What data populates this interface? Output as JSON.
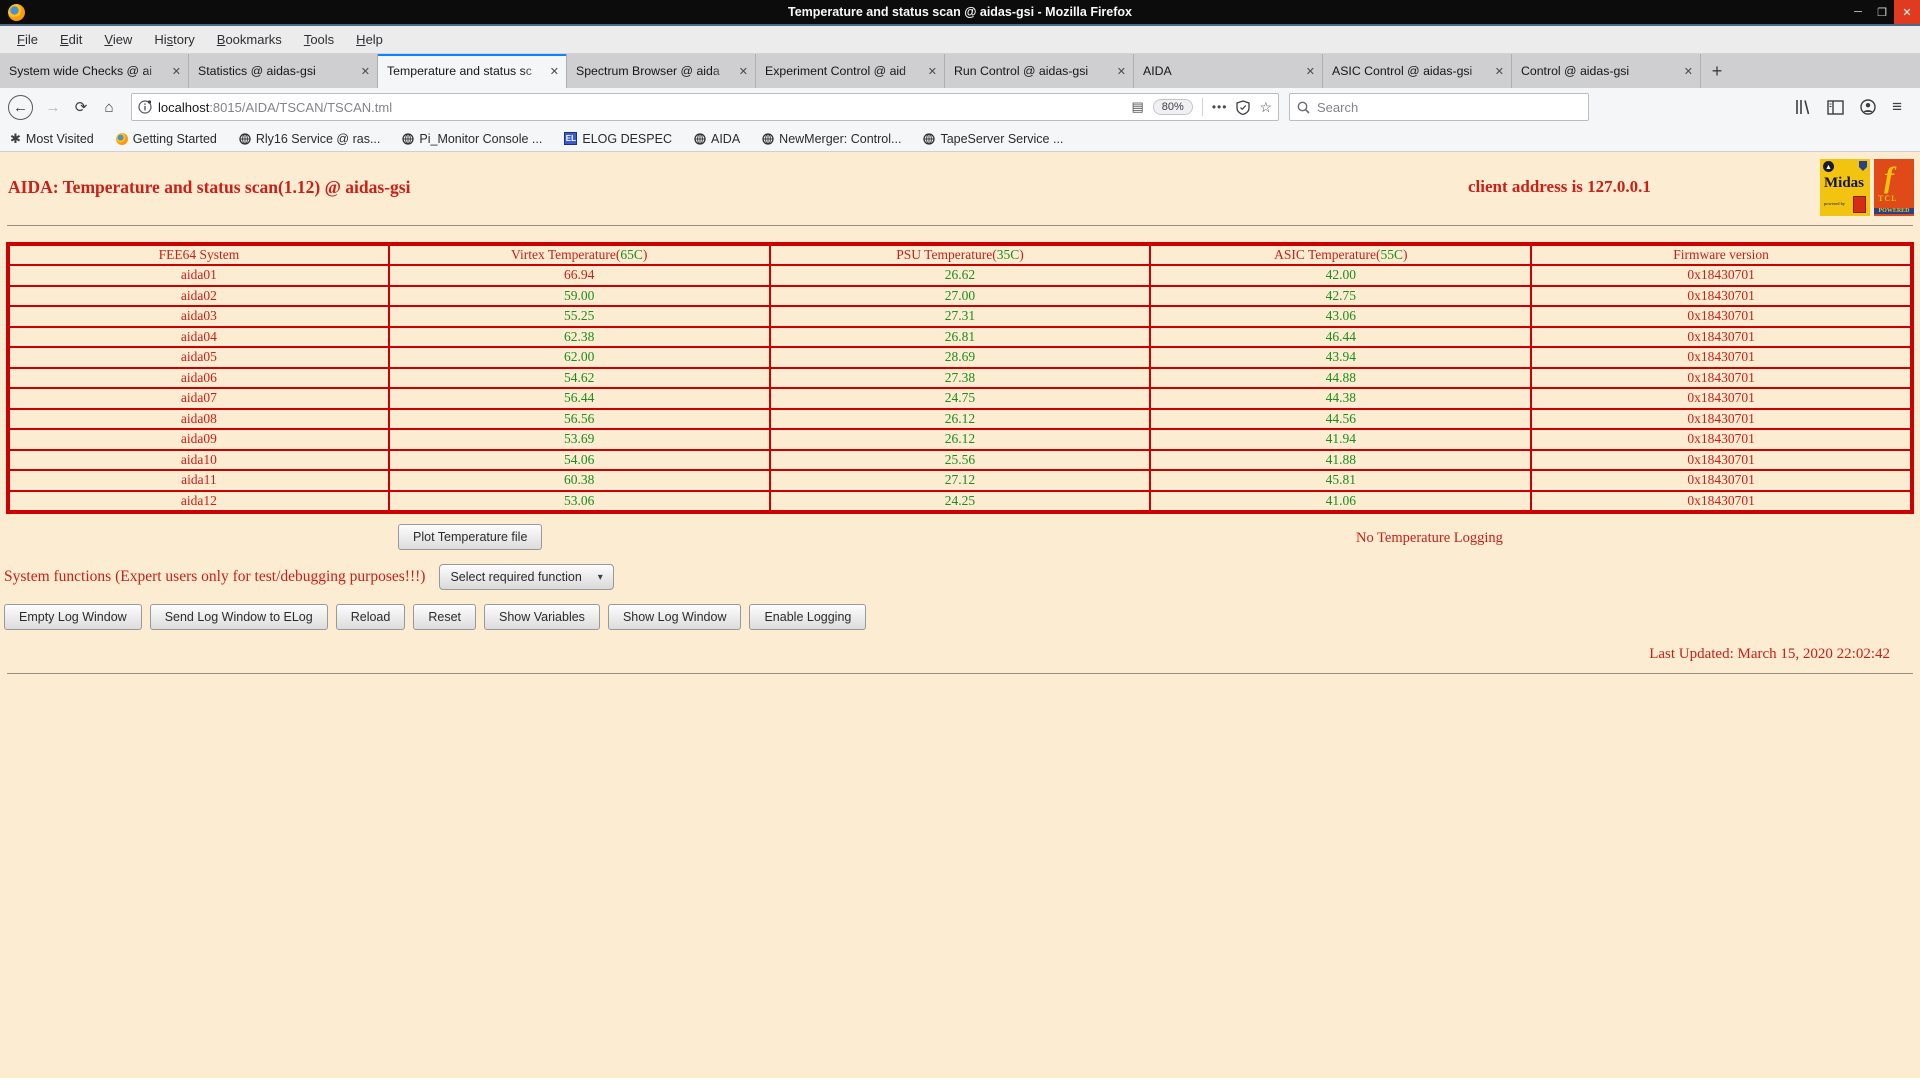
{
  "window": {
    "title": "Temperature and status scan @ aidas-gsi - Mozilla Firefox",
    "minimize": "─",
    "maximize": "❐",
    "close": "✕"
  },
  "menu": {
    "items": [
      {
        "pre": "",
        "accel": "F",
        "post": "ile"
      },
      {
        "pre": "",
        "accel": "E",
        "post": "dit"
      },
      {
        "pre": "",
        "accel": "V",
        "post": "iew"
      },
      {
        "pre": "Hi",
        "accel": "s",
        "post": "tory"
      },
      {
        "pre": "",
        "accel": "B",
        "post": "ookmarks"
      },
      {
        "pre": "",
        "accel": "T",
        "post": "ools"
      },
      {
        "pre": "",
        "accel": "H",
        "post": "elp"
      }
    ]
  },
  "tabs": {
    "close_glyph": "✕",
    "new_tab": "+",
    "items": [
      {
        "label": "System wide Checks @ ai",
        "active": false
      },
      {
        "label": "Statistics @ aidas-gsi",
        "active": false
      },
      {
        "label": "Temperature and status sc",
        "active": true
      },
      {
        "label": "Spectrum Browser @ aida",
        "active": false
      },
      {
        "label": "Experiment Control @ aid",
        "active": false
      },
      {
        "label": "Run Control @ aidas-gsi",
        "active": false
      },
      {
        "label": "AIDA",
        "active": false
      },
      {
        "label": "ASIC Control @ aidas-gsi",
        "active": false
      },
      {
        "label": "Control @ aidas-gsi",
        "active": false
      }
    ]
  },
  "nav": {
    "back": "←",
    "forward": "→",
    "reload": "⟳",
    "home": "⌂",
    "url_host": "localhost",
    "url_path": ":8015/AIDA/TSCAN/TSCAN.tml",
    "reader": "▤",
    "zoom_level": "80%",
    "overflow": "•••",
    "star": "☆",
    "search_placeholder": "Search",
    "hamburger": "≡"
  },
  "bookmarks": {
    "elog_badge": "EL",
    "items": [
      {
        "icon": "gear",
        "label": "Most Visited"
      },
      {
        "icon": "firefox",
        "label": "Getting Started"
      },
      {
        "icon": "globe",
        "label": "Rly16 Service @ ras..."
      },
      {
        "icon": "globe",
        "label": "Pi_Monitor Console ..."
      },
      {
        "icon": "elog",
        "label": "ELOG DESPEC"
      },
      {
        "icon": "globe",
        "label": "AIDA"
      },
      {
        "icon": "globe",
        "label": "NewMerger: Control..."
      },
      {
        "icon": "globe",
        "label": "TapeServer Service ..."
      }
    ]
  },
  "page": {
    "heading": "AIDA: Temperature and status scan(1.12) @ aidas-gsi",
    "client_address": "client address is 127.0.0.1",
    "logos": {
      "midas_text": "Midas",
      "midas_sub": "powered by",
      "tcl_text": "TCL",
      "tcl_sub": "POWERED",
      "tcl_feather": "f"
    },
    "table": {
      "headers": [
        {
          "text": "FEE64 System"
        },
        {
          "pre": "Virtex Temperature(",
          "threshold": "65C",
          "post": ")"
        },
        {
          "pre": "PSU Temperature(",
          "threshold": "35C",
          "post": ")"
        },
        {
          "pre": "ASIC Temperature(",
          "threshold": "55C",
          "post": ")"
        },
        {
          "text": "Firmware version"
        }
      ],
      "rows": [
        {
          "name": "aida01",
          "virtex": "66.94",
          "virtex_alarm": true,
          "psu": "26.62",
          "asic": "42.00",
          "firmware": "0x18430701"
        },
        {
          "name": "aida02",
          "virtex": "59.00",
          "psu": "27.00",
          "asic": "42.75",
          "firmware": "0x18430701"
        },
        {
          "name": "aida03",
          "virtex": "55.25",
          "psu": "27.31",
          "asic": "43.06",
          "firmware": "0x18430701"
        },
        {
          "name": "aida04",
          "virtex": "62.38",
          "psu": "26.81",
          "asic": "46.44",
          "firmware": "0x18430701"
        },
        {
          "name": "aida05",
          "virtex": "62.00",
          "psu": "28.69",
          "asic": "43.94",
          "firmware": "0x18430701"
        },
        {
          "name": "aida06",
          "virtex": "54.62",
          "psu": "27.38",
          "asic": "44.88",
          "firmware": "0x18430701"
        },
        {
          "name": "aida07",
          "virtex": "56.44",
          "psu": "24.75",
          "asic": "44.38",
          "firmware": "0x18430701"
        },
        {
          "name": "aida08",
          "virtex": "56.56",
          "psu": "26.12",
          "asic": "44.56",
          "firmware": "0x18430701"
        },
        {
          "name": "aida09",
          "virtex": "53.69",
          "psu": "26.12",
          "asic": "41.94",
          "firmware": "0x18430701"
        },
        {
          "name": "aida10",
          "virtex": "54.06",
          "psu": "25.56",
          "asic": "41.88",
          "firmware": "0x18430701"
        },
        {
          "name": "aida11",
          "virtex": "60.38",
          "psu": "27.12",
          "asic": "45.81",
          "firmware": "0x18430701"
        },
        {
          "name": "aida12",
          "virtex": "53.06",
          "psu": "24.25",
          "asic": "41.06",
          "firmware": "0x18430701"
        }
      ]
    },
    "plot_button": "Plot Temperature file",
    "no_logging": "No Temperature Logging",
    "system_functions_label": "System functions (Expert users only for test/debugging purposes!!!)",
    "function_select": "Select required function",
    "action_buttons": [
      "Empty Log Window",
      "Send Log Window to ELog",
      "Reload",
      "Reset",
      "Show Variables",
      "Show Log Window",
      "Enable Logging"
    ],
    "last_updated": "Last Updated: March 15, 2020 22:02:42"
  },
  "colors": {
    "page_bg": "#fcecd2",
    "red": "#cc1f17",
    "green": "#1d8c1d",
    "border_red": "#cc0000",
    "accent_blue": "#0a84ff"
  }
}
